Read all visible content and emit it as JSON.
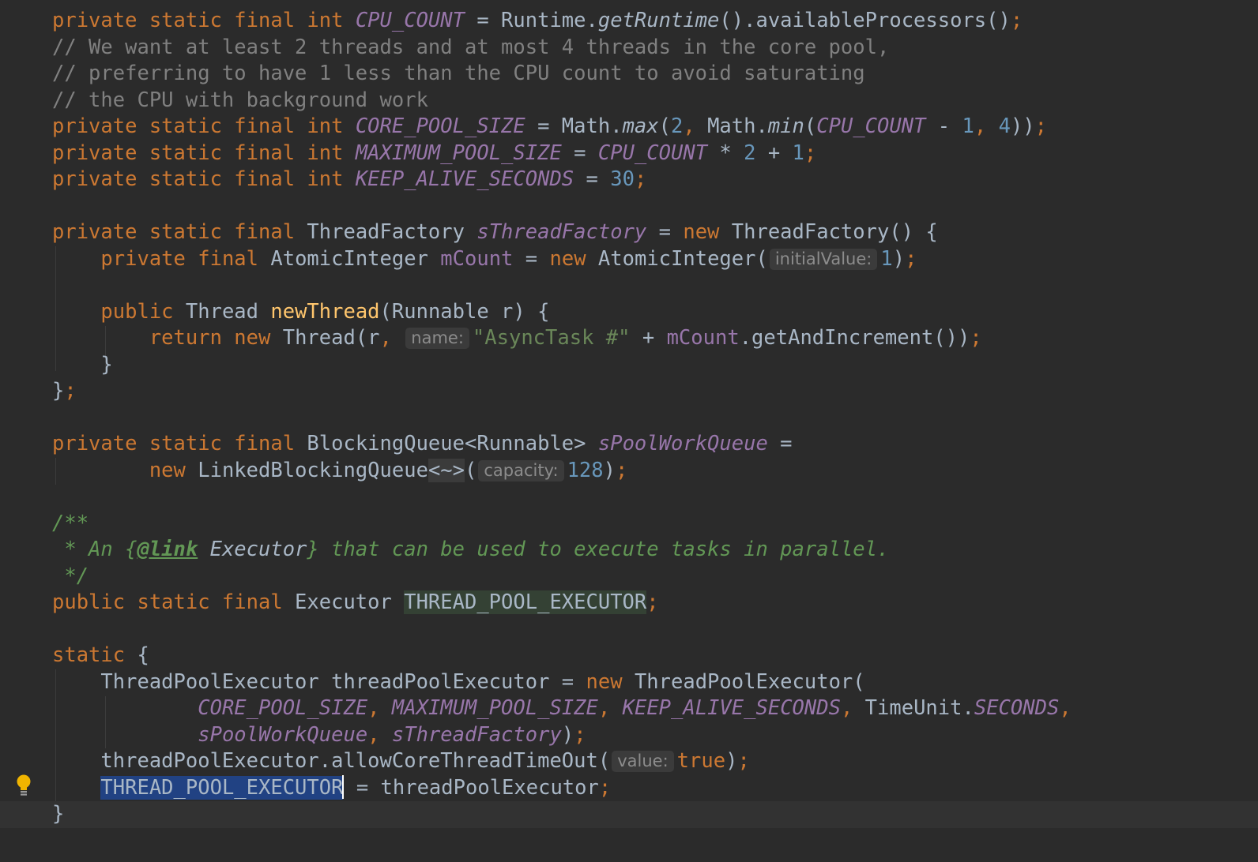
{
  "editor": {
    "lines": [
      [
        [
          "kw",
          "private static final int "
        ],
        [
          "sf",
          "CPU_COUNT"
        ],
        [
          "p",
          " = Runtime."
        ],
        [
          "it",
          "getRuntime"
        ],
        [
          "p",
          "().availableProcessors()"
        ],
        [
          "kw",
          ";"
        ]
      ],
      [
        [
          "cm",
          "// We want at least 2 threads and at most 4 threads in the core pool,"
        ]
      ],
      [
        [
          "cm",
          "// preferring to have 1 less than the CPU count to avoid saturating"
        ]
      ],
      [
        [
          "cm",
          "// the CPU with background work"
        ]
      ],
      [
        [
          "kw",
          "private static final int "
        ],
        [
          "sf",
          "CORE_POOL_SIZE"
        ],
        [
          "p",
          " = Math."
        ],
        [
          "it",
          "max"
        ],
        [
          "p",
          "("
        ],
        [
          "num",
          "2"
        ],
        [
          "kw",
          ", "
        ],
        [
          "p",
          "Math."
        ],
        [
          "it",
          "min"
        ],
        [
          "p",
          "("
        ],
        [
          "sf",
          "CPU_COUNT"
        ],
        [
          "p",
          " - "
        ],
        [
          "num",
          "1"
        ],
        [
          "kw",
          ", "
        ],
        [
          "num",
          "4"
        ],
        [
          "p",
          "))"
        ],
        [
          "kw",
          ";"
        ]
      ],
      [
        [
          "kw",
          "private static final int "
        ],
        [
          "sf",
          "MAXIMUM_POOL_SIZE"
        ],
        [
          "p",
          " = "
        ],
        [
          "sf",
          "CPU_COUNT"
        ],
        [
          "p",
          " * "
        ],
        [
          "num",
          "2"
        ],
        [
          "p",
          " + "
        ],
        [
          "num",
          "1"
        ],
        [
          "kw",
          ";"
        ]
      ],
      [
        [
          "kw",
          "private static final int "
        ],
        [
          "sf",
          "KEEP_ALIVE_SECONDS"
        ],
        [
          "p",
          " = "
        ],
        [
          "num",
          "30"
        ],
        [
          "kw",
          ";"
        ]
      ],
      [],
      [
        [
          "kw",
          "private static final "
        ],
        [
          "p",
          "ThreadFactory "
        ],
        [
          "sf",
          "sThreadFactory"
        ],
        [
          "p",
          " = "
        ],
        [
          "kw",
          "new "
        ],
        [
          "p",
          "ThreadFactory() {"
        ]
      ],
      [
        [
          "p",
          "    "
        ],
        [
          "kw",
          "private final "
        ],
        [
          "p",
          "AtomicInteger "
        ],
        [
          "fld",
          "mCount"
        ],
        [
          "p",
          " = "
        ],
        [
          "kw",
          "new "
        ],
        [
          "p",
          "AtomicInteger("
        ],
        [
          "hint",
          "initialValue:"
        ],
        [
          "num",
          "1"
        ],
        [
          "p",
          ")"
        ],
        [
          "kw",
          ";"
        ]
      ],
      [],
      [
        [
          "p",
          "    "
        ],
        [
          "kw",
          "public "
        ],
        [
          "p",
          "Thread "
        ],
        [
          "meth",
          "newThread"
        ],
        [
          "p",
          "(Runnable r) {"
        ]
      ],
      [
        [
          "p",
          "        "
        ],
        [
          "kw",
          "return new "
        ],
        [
          "p",
          "Thread(r"
        ],
        [
          "kw",
          ", "
        ],
        [
          "hint",
          "name:"
        ],
        [
          "str",
          "\"AsyncTask #\""
        ],
        [
          "p",
          " + "
        ],
        [
          "fld",
          "mCount"
        ],
        [
          "p",
          ".getAndIncrement())"
        ],
        [
          "kw",
          ";"
        ]
      ],
      [
        [
          "p",
          "    }"
        ]
      ],
      [
        [
          "p",
          "}"
        ],
        [
          "kw",
          ";"
        ]
      ],
      [],
      [
        [
          "kw",
          "private static final "
        ],
        [
          "p",
          "BlockingQueue<Runnable> "
        ],
        [
          "sf",
          "sPoolWorkQueue"
        ],
        [
          "p",
          " ="
        ]
      ],
      [
        [
          "p",
          "        "
        ],
        [
          "kw",
          "new "
        ],
        [
          "p",
          "LinkedBlockingQueue"
        ],
        [
          "diamond",
          "<~>"
        ],
        [
          "p",
          "("
        ],
        [
          "hint",
          "capacity:"
        ],
        [
          "num",
          "128"
        ],
        [
          "p",
          ")"
        ],
        [
          "kw",
          ";"
        ]
      ],
      [],
      [
        [
          "doc",
          "/**"
        ]
      ],
      [
        [
          "doc",
          " * An {"
        ],
        [
          "doctag",
          "@link"
        ],
        [
          "docref",
          " Executor"
        ],
        [
          "doc",
          "} that can be used to execute tasks in parallel."
        ]
      ],
      [
        [
          "doc",
          " */"
        ]
      ],
      [
        [
          "kw",
          "public static final "
        ],
        [
          "p",
          "Executor "
        ],
        [
          "usage",
          "THREAD_POOL_EXECUTOR"
        ],
        [
          "kw",
          ";"
        ]
      ],
      [],
      [
        [
          "kw",
          "static "
        ],
        [
          "p",
          "{"
        ]
      ],
      [
        [
          "p",
          "    ThreadPoolExecutor threadPoolExecutor = "
        ],
        [
          "kw",
          "new "
        ],
        [
          "p",
          "ThreadPoolExecutor("
        ]
      ],
      [
        [
          "p",
          "            "
        ],
        [
          "sf",
          "CORE_POOL_SIZE"
        ],
        [
          "kw",
          ", "
        ],
        [
          "sf",
          "MAXIMUM_POOL_SIZE"
        ],
        [
          "kw",
          ", "
        ],
        [
          "sf",
          "KEEP_ALIVE_SECONDS"
        ],
        [
          "kw",
          ", "
        ],
        [
          "p",
          "TimeUnit."
        ],
        [
          "sf",
          "SECONDS"
        ],
        [
          "kw",
          ","
        ]
      ],
      [
        [
          "p",
          "            "
        ],
        [
          "sf",
          "sPoolWorkQueue"
        ],
        [
          "kw",
          ", "
        ],
        [
          "sf",
          "sThreadFactory"
        ],
        [
          "p",
          ")"
        ],
        [
          "kw",
          ";"
        ]
      ],
      [
        [
          "p",
          "    threadPoolExecutor.allowCoreThreadTimeOut("
        ],
        [
          "hint",
          "value:"
        ],
        [
          "kw",
          "true"
        ],
        [
          "p",
          ")"
        ],
        [
          "kw",
          ";"
        ]
      ],
      [
        [
          "p",
          "    "
        ],
        [
          "selected",
          "THREAD_POOL_EXECUTOR"
        ],
        [
          "caret",
          ""
        ],
        [
          "p",
          " = threadPoolExecutor"
        ],
        [
          "kw",
          ";"
        ]
      ],
      [
        [
          "p",
          "}"
        ]
      ]
    ],
    "current_line": 30,
    "colors": {
      "background": "#2b2b2b",
      "keyword": "#cc7832",
      "comment": "#808080",
      "doc_comment": "#629755",
      "static_field": "#9876aa",
      "number": "#6897bb",
      "string": "#6a8759",
      "method_declaration": "#ffc66d",
      "default_text": "#a9b7c6",
      "selection": "#214283"
    },
    "gutter_icon": "lightbulb-icon"
  }
}
